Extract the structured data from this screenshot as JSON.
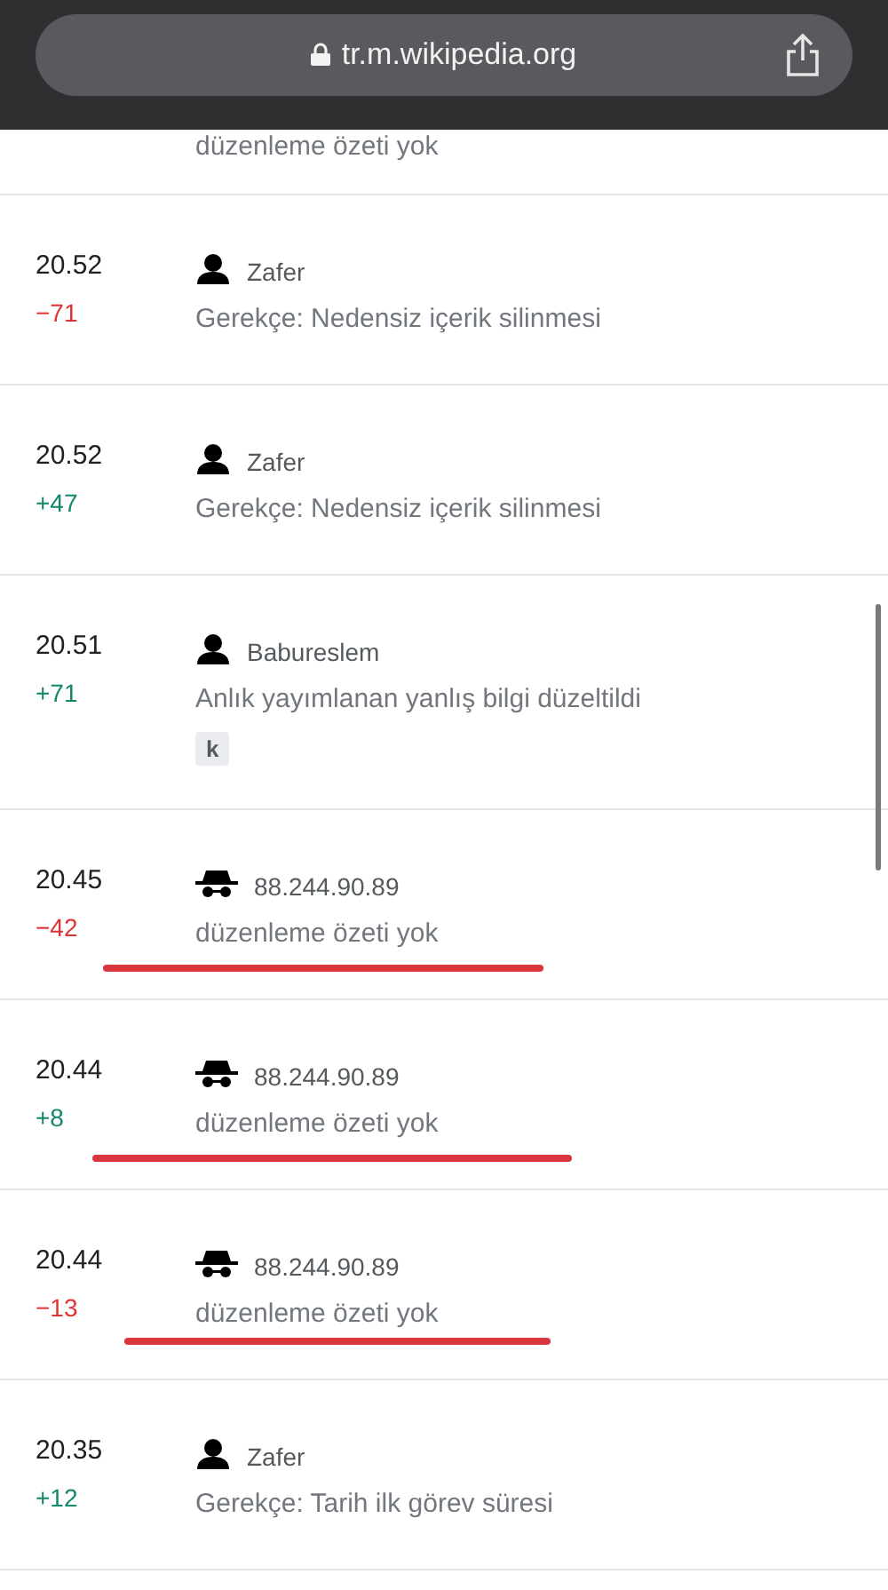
{
  "browser": {
    "url": "tr.m.wikipedia.org"
  },
  "partial_row": {
    "summary": "düzenleme özeti yok"
  },
  "revisions": [
    {
      "time": "20.52",
      "diff": "−71",
      "color": "#dd3333",
      "user": "Zafer",
      "kind": "registered",
      "summary": "Gerekçe: Nedensiz içerik silinmesi",
      "underlined": false
    },
    {
      "time": "20.52",
      "diff": "+47",
      "color": "#14866d",
      "user": "Zafer",
      "kind": "registered",
      "summary": "Gerekçe: Nedensiz içerik silinmesi",
      "underlined": false
    },
    {
      "time": "20.51",
      "diff": "+71",
      "color": "#14866d",
      "user": "Babureslem",
      "kind": "registered",
      "summary": "Anlık yayımlanan yanlış bilgi düzeltildi",
      "tag": "k",
      "underlined": false
    },
    {
      "time": "20.45",
      "diff": "−42",
      "color": "#dd3333",
      "user": "88.244.90.89",
      "kind": "anonymous",
      "summary": "düzenleme özeti yok",
      "underlined": true
    },
    {
      "time": "20.44",
      "diff": "+8",
      "color": "#14866d",
      "user": "88.244.90.89",
      "kind": "anonymous",
      "summary": "düzenleme özeti yok",
      "underlined": true
    },
    {
      "time": "20.44",
      "diff": "−13",
      "color": "#dd3333",
      "user": "88.244.90.89",
      "kind": "anonymous",
      "summary": "düzenleme özeti yok",
      "underlined": true
    },
    {
      "time": "20.35",
      "diff": "+12",
      "color": "#14866d",
      "user": "Zafer",
      "kind": "registered",
      "summary": "Gerekçe: Tarih ilk görev süresi",
      "underlined": false
    }
  ]
}
